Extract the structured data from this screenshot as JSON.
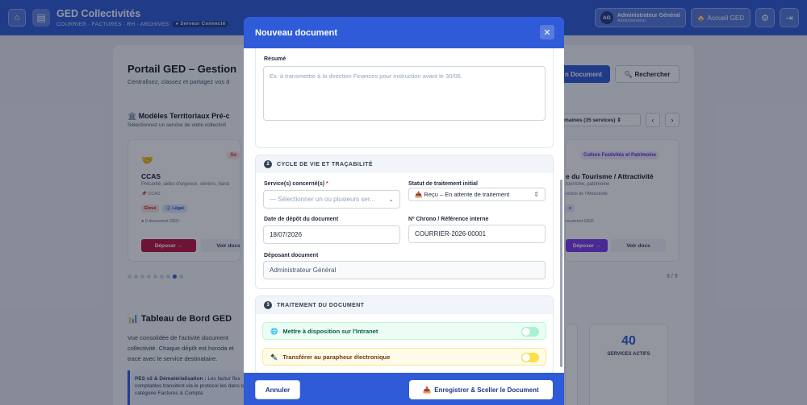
{
  "topbar": {
    "app_title": "GED Collectivités",
    "app_subtitle": "COURRIER · FACTURES · RH · ARCHIVES",
    "server_badge": "● Serveur Connecté",
    "user_initials": "AG",
    "user_name": "Administrateur Général",
    "user_role": "Administrateur",
    "home_label": "Accueil GED",
    "home_icon": "🏠"
  },
  "page": {
    "title": "Portail GED – Gestion",
    "subtitle": "Centralisez, classez et partagez vos d",
    "new_doc_label": "n Document",
    "search_label": "Rechercher",
    "search_icon": "🔍",
    "models_title": "Modèles Territoriaux Pré-c",
    "models_icon": "🏛️",
    "models_subtitle": "Sélectionnez un service de votre collectivit",
    "domain_filter": "omaines (35 services)  ⇕",
    "pager": "8 / 9"
  },
  "cards": [
    {
      "emoji": "🤝",
      "tag": "So",
      "name": "CCAS",
      "description": "Précarité, aides d'urgence, séniors, hand",
      "category": "📌 CCAS",
      "pill1": "Élevé",
      "pill2": "⚖️ Légal",
      "doc_count": "0 document GED",
      "deposit_label": "Déposer →",
      "view_label": "Voir docs"
    },
    {
      "tag": "Culture Festivités et Patrimoine",
      "name": "e du Tourisme / Attractivité",
      "description": "tourisme, patrimoine",
      "category": "ection de l'Attractivité",
      "pill1": "e",
      "doc_count": "ocument GED",
      "deposit_label": "Déposer →",
      "view_label": "Voir docs"
    }
  ],
  "dashboard": {
    "title": "Tableau de Bord GED",
    "icon": "📊",
    "description": "Vue consolidée de l'activité document collectivité. Chaque dépôt est horoda et tracé avec le service destinataire.",
    "pes_bold": "PES v2 & Dématérialisation :",
    "pes_text": " Les factur flux comptables transitent via le protocol les dans la catégorie Factures & Compta",
    "stat_value": "40",
    "stat_label": "SERVICES ACTIFS"
  },
  "modal": {
    "title": "Nouveau document",
    "close_icon": "✕",
    "summary_label": "Résumé",
    "summary_placeholder": "Ex: à transmettre à la direction Finances pour instruction avant le 30/06.",
    "section2": {
      "number": "2",
      "title": "CYCLE DE VIE ET TRAÇABILITÉ",
      "services_label": "Service(s) concerné(s)",
      "services_required": "*",
      "services_placeholder": "— Sélectionner un ou plusieurs ser...",
      "status_label": "Statut de traitement initial",
      "status_value": "📥 Reçu – En attente de traitement",
      "date_label": "Date de dépôt du document",
      "date_value": "18/07/2026",
      "chrono_label": "Nº Chrono / Référence interne",
      "chrono_value": "COURRIER-2026-00001",
      "depositor_label": "Déposant document",
      "depositor_value": "Administrateur Général"
    },
    "section3": {
      "number": "3",
      "title": "TRAITEMENT DU DOCUMENT",
      "intranet_icon": "🌐",
      "intranet_label": "Mettre à disposition sur l'Intranet",
      "intranet_on": false,
      "parapheur_icon": "✒️",
      "parapheur_label": "Transférer au parapheur électronique",
      "parapheur_on": false
    },
    "cancel_label": "Annuler",
    "save_icon": "📥",
    "save_label": "Enregistrer & Sceller le Document"
  },
  "colors": {
    "primary": "#2f5bd8",
    "danger": "#dc2626",
    "purple": "#7c3aed",
    "intranet_bg": "#ecfdf5",
    "parapheur_bg": "#fefce8"
  }
}
